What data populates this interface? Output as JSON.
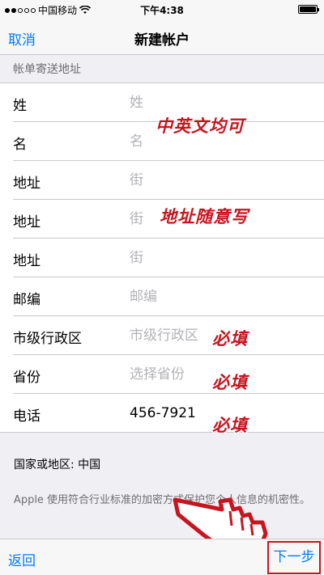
{
  "status_bar": {
    "carrier": "中国移动",
    "time": "下午4:38"
  },
  "nav": {
    "cancel_label": "取消",
    "title": "新建帐户"
  },
  "section": {
    "header": "帐单寄送地址"
  },
  "form": {
    "rows": [
      {
        "label": "姓",
        "placeholder": "姓",
        "value": ""
      },
      {
        "label": "名",
        "placeholder": "名",
        "value": ""
      },
      {
        "label": "地址",
        "placeholder": "街",
        "value": ""
      },
      {
        "label": "地址",
        "placeholder": "街",
        "value": ""
      },
      {
        "label": "地址",
        "placeholder": "街",
        "value": ""
      },
      {
        "label": "邮编",
        "placeholder": "邮编",
        "value": ""
      },
      {
        "label": "市级行政区",
        "placeholder": "市级行政区",
        "value": ""
      },
      {
        "label": "省份",
        "placeholder": "选择省份",
        "value": ""
      },
      {
        "label": "电话",
        "placeholder": "",
        "value": "456-7921"
      }
    ]
  },
  "annotations": {
    "name_note": "中英文均可",
    "address_note": "地址随意写",
    "city_required": "必填",
    "province_required": "必填",
    "phone_required": "必填"
  },
  "country": {
    "text": "国家或地区: 中国"
  },
  "privacy": {
    "text": "Apple 使用符合行业标准的加密方式保护您个人信息的机密性。"
  },
  "bottom": {
    "back_label": "返回",
    "next_label": "下一步"
  },
  "colors": {
    "accent": "#007aff",
    "annotation": "#c8141e",
    "background": "#efeff4"
  }
}
